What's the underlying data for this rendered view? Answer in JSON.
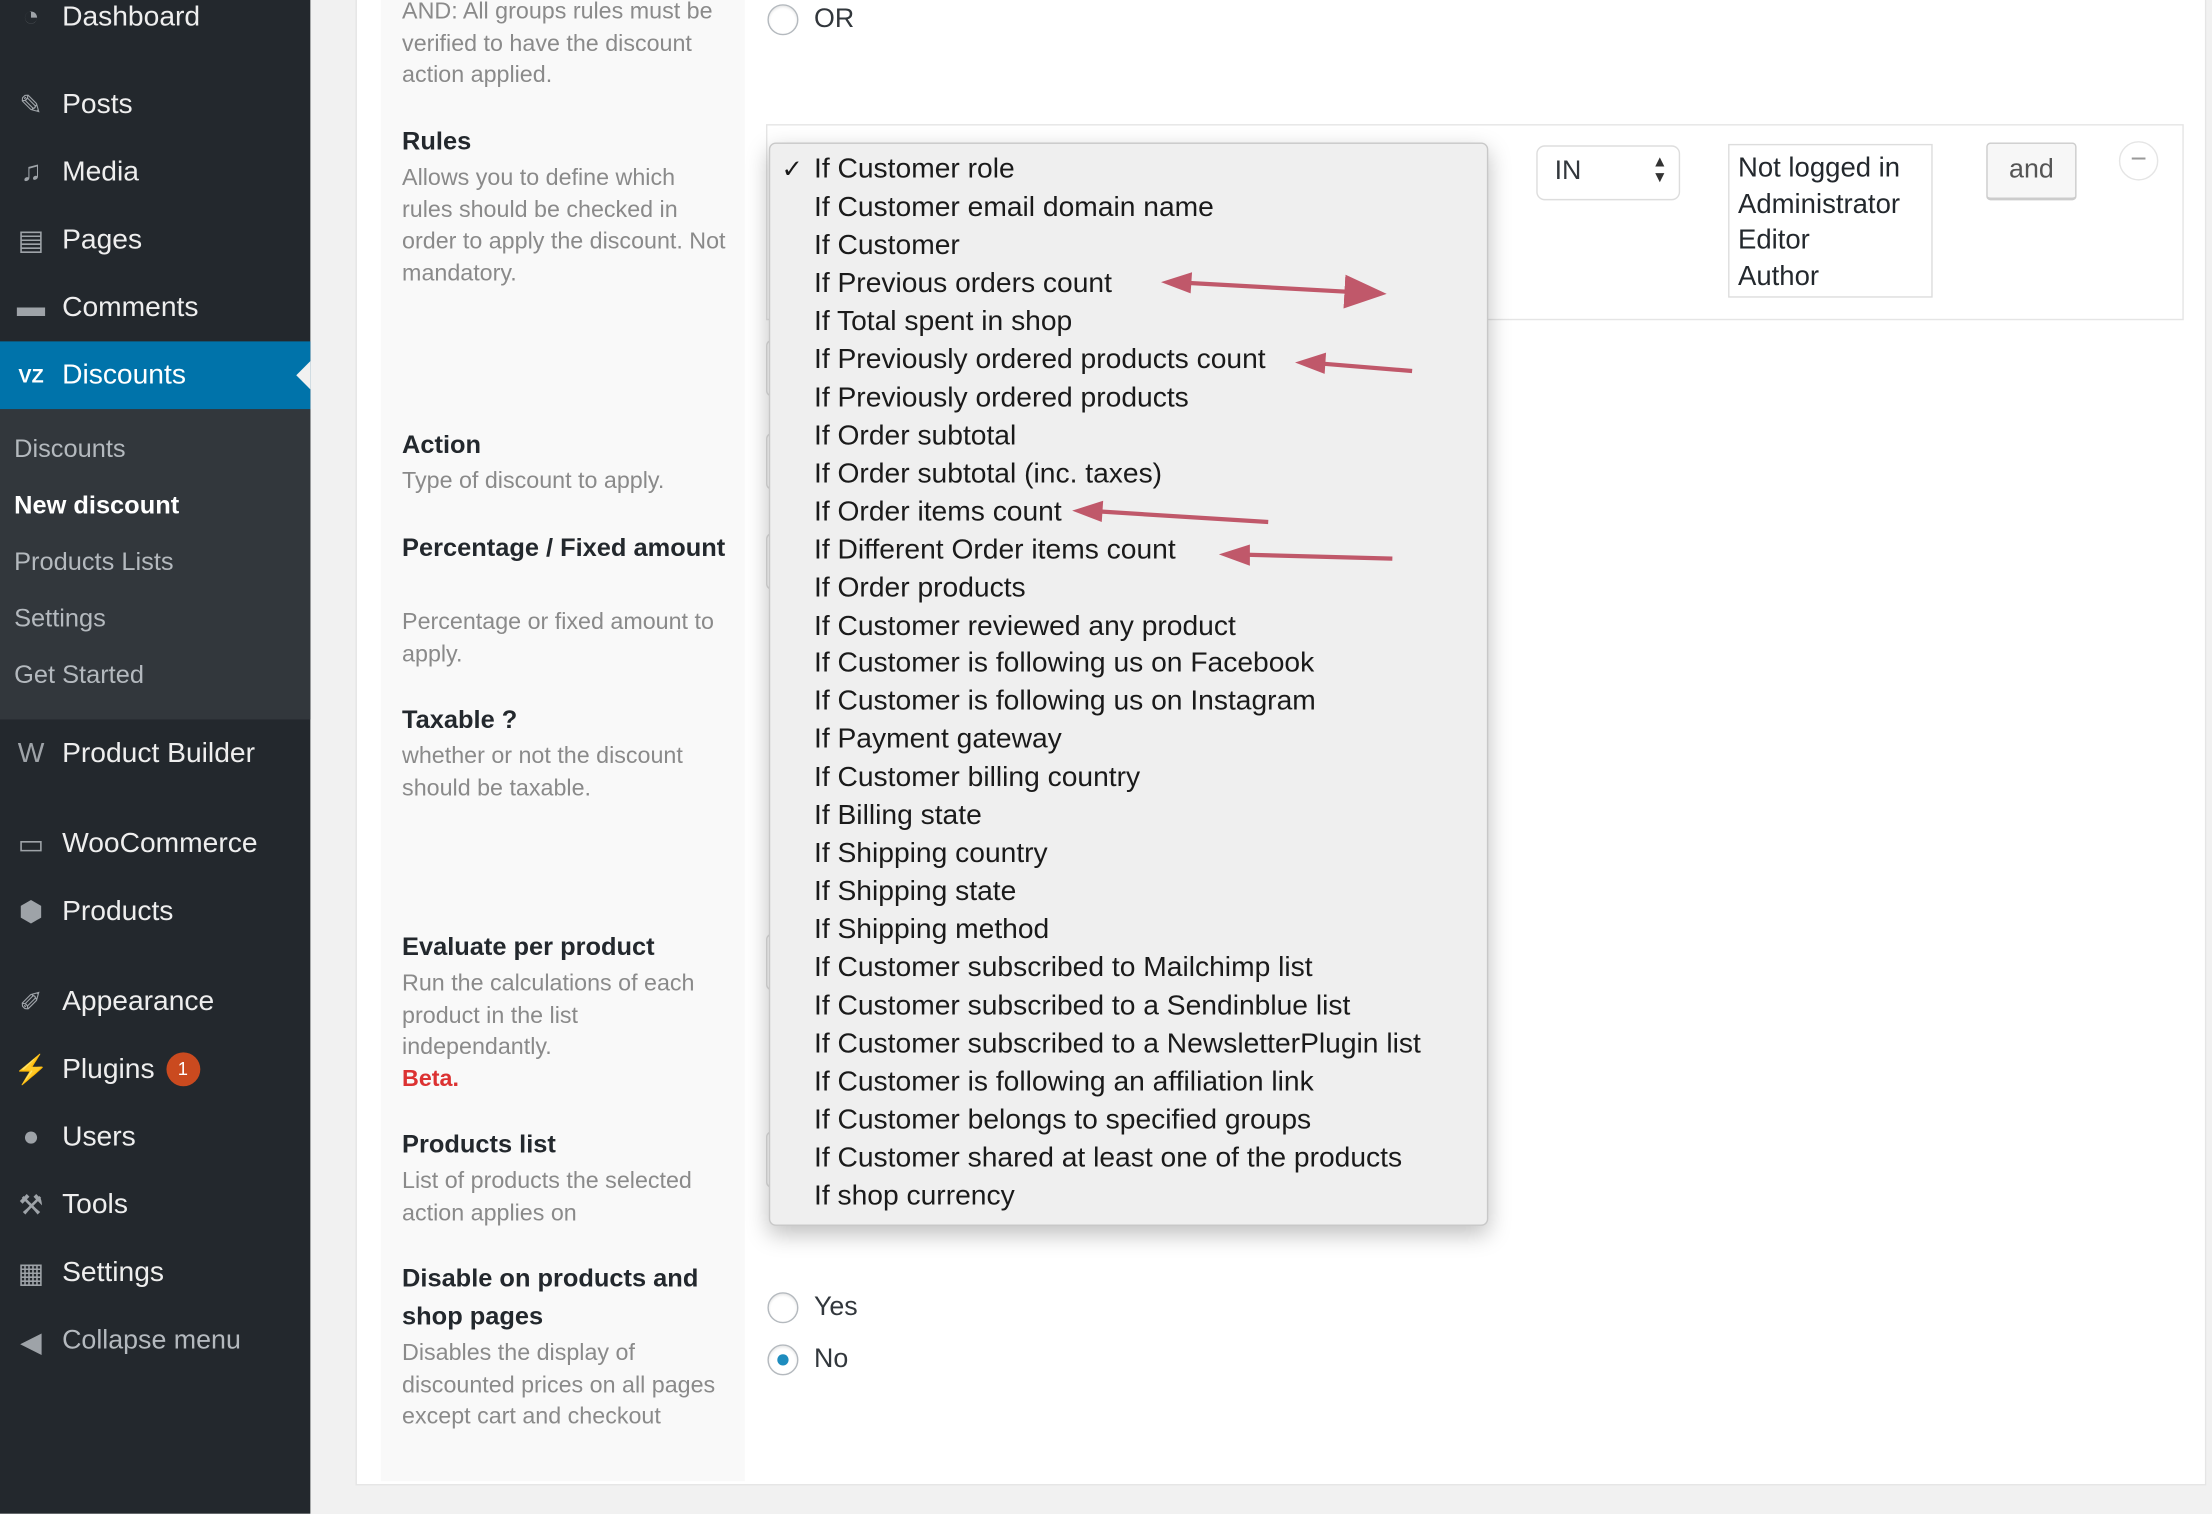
{
  "sidebar": {
    "items": [
      {
        "label": "Dashboard",
        "icon": "dashboard-icon"
      },
      {
        "label": "Posts",
        "icon": "pin-icon"
      },
      {
        "label": "Media",
        "icon": "media-icon"
      },
      {
        "label": "Pages",
        "icon": "pages-icon"
      },
      {
        "label": "Comments",
        "icon": "comment-icon"
      },
      {
        "label": "Discounts",
        "icon": "discounts-logo-icon"
      },
      {
        "label": "Product Builder",
        "icon": "product-builder-logo-icon"
      },
      {
        "label": "WooCommerce",
        "icon": "woo-icon"
      },
      {
        "label": "Products",
        "icon": "box-icon"
      },
      {
        "label": "Appearance",
        "icon": "brush-icon"
      },
      {
        "label": "Plugins",
        "icon": "plugin-icon",
        "badge": "1"
      },
      {
        "label": "Users",
        "icon": "user-icon"
      },
      {
        "label": "Tools",
        "icon": "wrench-icon"
      },
      {
        "label": "Settings",
        "icon": "settings-icon"
      },
      {
        "label": "Collapse menu",
        "icon": "collapse-icon"
      }
    ],
    "submenu": [
      "Discounts",
      "New discount",
      "Products Lists",
      "Settings",
      "Get Started"
    ],
    "accent": "#0073aa"
  },
  "form": {
    "relation_desc": "AND: All groups rules must be verified to have the discount action applied.",
    "or_label": "OR",
    "rules_title": "Rules",
    "rules_desc": "Allows you to define which rules should be checked in order to apply the discount. Not mandatory.",
    "action_title": "Action",
    "action_desc": "Type of discount to apply.",
    "amount_title": "Percentage / Fixed amount",
    "amount_desc": "Percentage or fixed amount to apply.",
    "taxable_title": "Taxable ?",
    "taxable_desc": "whether or not the discount should be taxable.",
    "evaluate_title": "Evaluate per product",
    "evaluate_desc": "Run the calculations of each product in the list independantly.",
    "evaluate_beta": "Beta.",
    "plist_title": "Products list",
    "plist_desc": "List of products the selected action applies on",
    "disable_title": "Disable on products and shop pages",
    "disable_desc": "Disables the display of discounted prices on all pages except cart and checkout",
    "yes_label": "Yes",
    "no_label": "No",
    "disable_selected": "No"
  },
  "rule": {
    "operator": "IN",
    "values": [
      "Not logged in",
      "Administrator",
      "Editor",
      "Author"
    ],
    "and_label": "and",
    "remove_label": "−"
  },
  "dropdown": {
    "selected": "If Customer role",
    "options": [
      "If Customer role",
      "If Customer email domain name",
      "If Customer",
      "If Previous orders count",
      "If Total spent in shop",
      "If Previously ordered products count",
      "If Previously ordered products",
      "If Order subtotal",
      "If Order subtotal (inc. taxes)",
      "If Order items count",
      "If Different Order items count",
      "If Order products",
      "If Customer reviewed any product",
      "If Customer is following us on Facebook",
      "If Customer is following us on Instagram",
      "If Payment gateway",
      "If Customer billing country",
      "If Billing state",
      "If Shipping country",
      "If Shipping state",
      "If Shipping method",
      "If Customer subscribed to Mailchimp list",
      "If Customer subscribed to a Sendinblue list",
      "If Customer subscribed to a NewsletterPlugin list",
      "If Customer is following an affiliation link",
      "If Customer belongs to specified groups",
      "If Customer shared at least one of the products",
      "If shop currency"
    ]
  },
  "annotations": {
    "arrow_color": "#c0586a",
    "highlighted": [
      "If Previous orders count",
      "If Previously ordered products count",
      "If Order items count",
      "If Different Order items count"
    ]
  }
}
